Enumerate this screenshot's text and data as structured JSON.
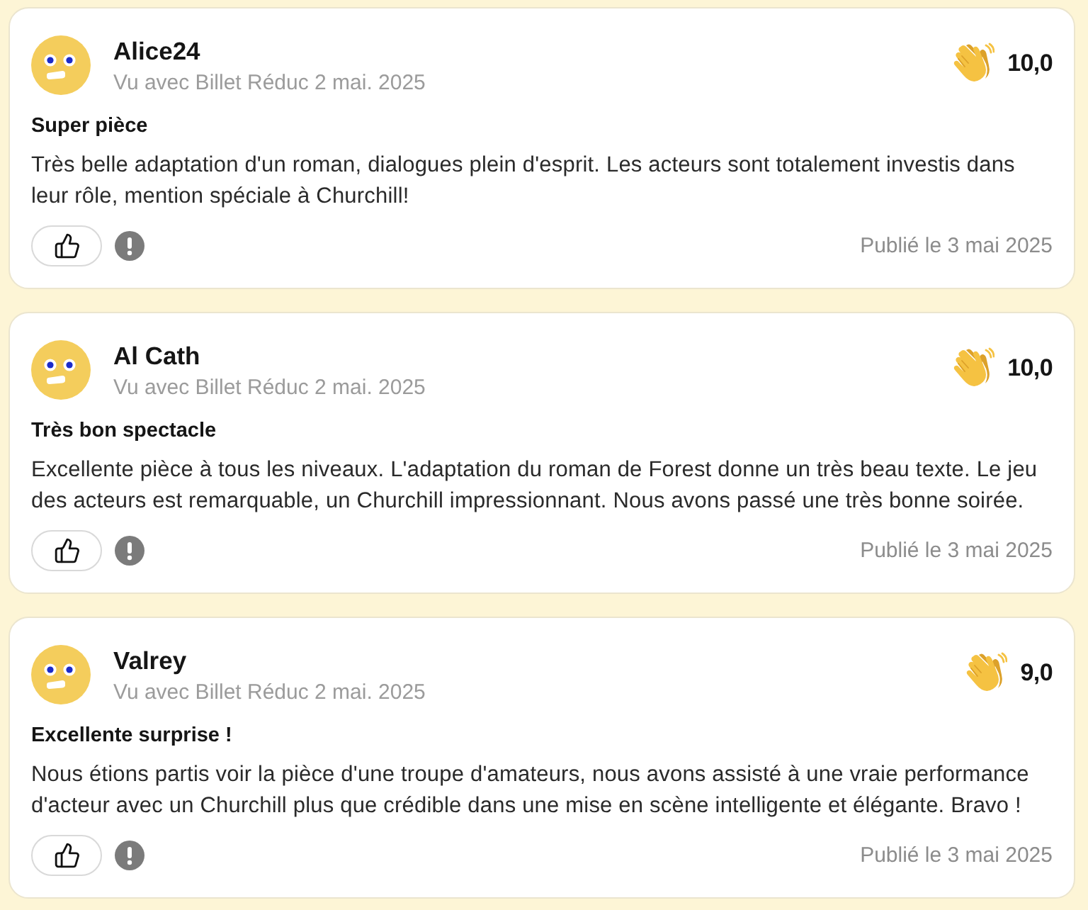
{
  "reviews": [
    {
      "author": "Alice24",
      "meta": "Vu avec Billet Réduc 2 mai. 2025",
      "score": "10,0",
      "title": "Super pièce",
      "body": "Très belle adaptation d'un roman, dialogues plein d'esprit. Les acteurs sont totalement investis dans leur rôle, mention spéciale à Churchill!",
      "published": "Publié le 3 mai 2025"
    },
    {
      "author": "Al Cath",
      "meta": "Vu avec Billet Réduc 2 mai. 2025",
      "score": "10,0",
      "title": "Très bon spectacle",
      "body": "Excellente pièce à tous les niveaux. L'adaptation du roman de Forest donne un très beau texte. Le jeu des acteurs est remarquable, un Churchill impressionnant. Nous avons passé une très bonne soirée.",
      "published": "Publié le 3 mai 2025"
    },
    {
      "author": "Valrey",
      "meta": "Vu avec Billet Réduc 2 mai. 2025",
      "score": "9,0",
      "title": "Excellente surprise !",
      "body": "Nous étions partis voir la pièce d'une troupe d'amateurs, nous avons assisté à une vraie performance d'acteur avec un Churchill plus que crédible dans une mise en scène intelligente et élégante. Bravo !",
      "published": "Publié le 3 mai 2025"
    }
  ]
}
